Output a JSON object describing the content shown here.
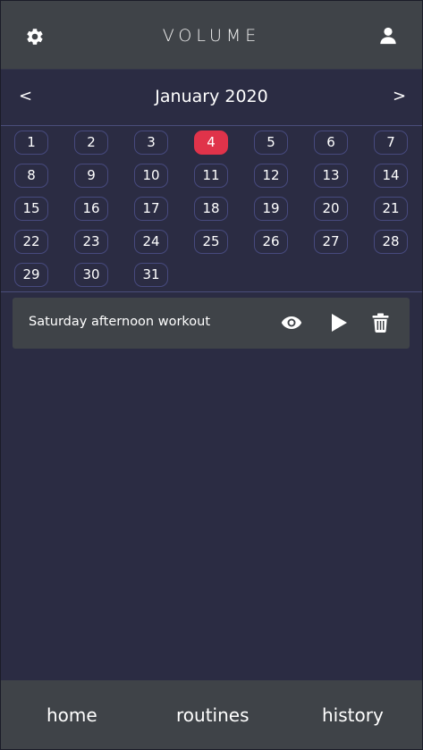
{
  "header": {
    "title": "VOLUME",
    "settings_icon": "gear-icon",
    "profile_icon": "user-icon"
  },
  "calendar": {
    "prev_label": "<",
    "next_label": ">",
    "month_label": "January 2020",
    "selected_day": 4,
    "selected_color": "#e0334a",
    "days": [
      "1",
      "2",
      "3",
      "4",
      "5",
      "6",
      "7",
      "8",
      "9",
      "10",
      "11",
      "12",
      "13",
      "14",
      "15",
      "16",
      "17",
      "18",
      "19",
      "20",
      "21",
      "22",
      "23",
      "24",
      "25",
      "26",
      "27",
      "28",
      "29",
      "30",
      "31"
    ]
  },
  "workouts": [
    {
      "name": "Saturday afternoon workout",
      "actions": [
        "eye-icon",
        "play-icon",
        "trash-icon"
      ]
    }
  ],
  "bottom_nav": {
    "home": "home",
    "routines": "routines",
    "history": "history"
  }
}
